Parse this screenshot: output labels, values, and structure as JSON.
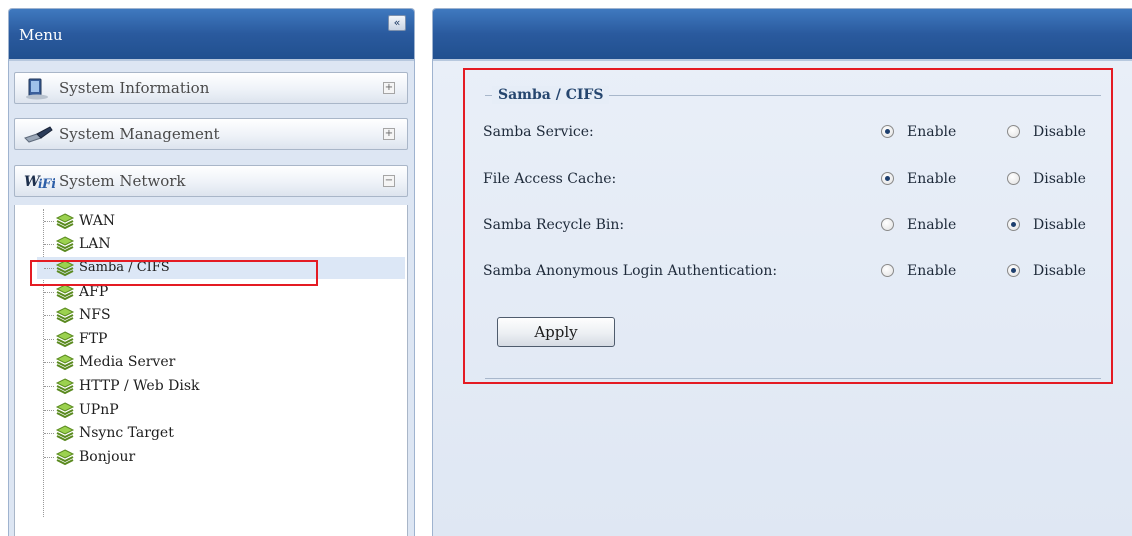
{
  "menu": {
    "title": "Menu",
    "collapse_glyph": "«",
    "sections": [
      {
        "label": "System Information",
        "icon": "computer-icon",
        "state": "+"
      },
      {
        "label": "System Management",
        "icon": "tools-icon",
        "state": "+"
      },
      {
        "label": "System Network",
        "icon": "wifi-icon",
        "state": "−"
      }
    ],
    "network_items": [
      {
        "label": "WAN"
      },
      {
        "label": "LAN"
      },
      {
        "label": "Samba / CIFS"
      },
      {
        "label": "AFP"
      },
      {
        "label": "NFS"
      },
      {
        "label": "FTP"
      },
      {
        "label": "Media Server"
      },
      {
        "label": "HTTP / Web Disk"
      },
      {
        "label": "UPnP"
      },
      {
        "label": "Nsync Target"
      },
      {
        "label": "Bonjour"
      }
    ],
    "selected_item": "Samba / CIFS"
  },
  "settings": {
    "legend": "Samba / CIFS",
    "enable_label": "Enable",
    "disable_label": "Disable",
    "rows": [
      {
        "label": "Samba Service:",
        "value": "Enable"
      },
      {
        "label": "File Access Cache:",
        "value": "Enable"
      },
      {
        "label": "Samba Recycle Bin:",
        "value": "Disable"
      },
      {
        "label": "Samba Anonymous Login Authentication:",
        "value": "Disable"
      }
    ],
    "apply_label": "Apply"
  },
  "colors": {
    "header_blue": "#2a5a9e",
    "highlight_red": "#e41b23",
    "legend_text": "#26466f"
  }
}
